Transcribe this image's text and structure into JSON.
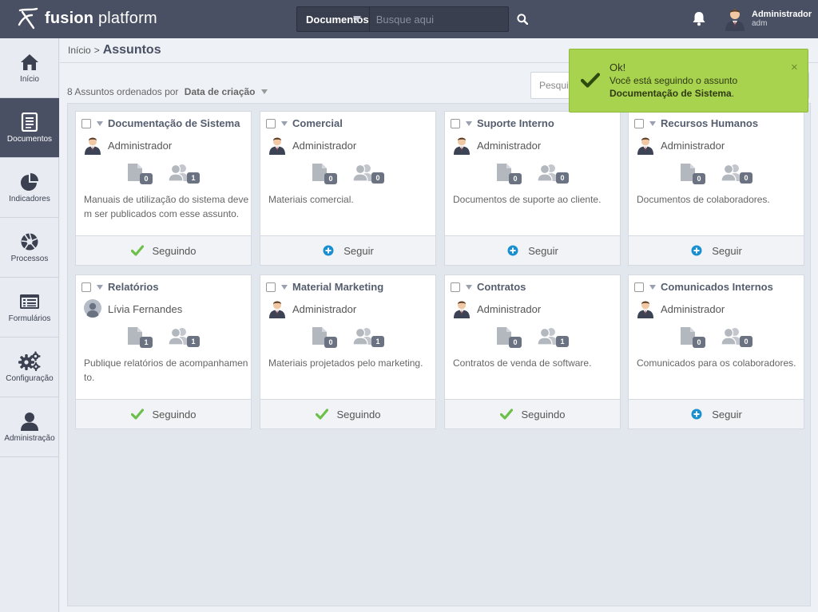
{
  "app": {
    "logo_brand": "fusion",
    "logo_suffix": " platform"
  },
  "search": {
    "module": "Documentos",
    "placeholder": "Busque aqui"
  },
  "user": {
    "name": "Administrador",
    "login": "adm"
  },
  "sidebar": {
    "items": [
      {
        "label": "Início",
        "icon": "home-icon"
      },
      {
        "label": "Documentos",
        "icon": "document-icon",
        "active": true
      },
      {
        "label": "Indicadores",
        "icon": "pie-chart-icon"
      },
      {
        "label": "Processos",
        "icon": "aperture-icon"
      },
      {
        "label": "Formulários",
        "icon": "form-icon"
      },
      {
        "label": "Configuração",
        "icon": "gears-icon"
      },
      {
        "label": "Administração",
        "icon": "user-icon"
      }
    ]
  },
  "breadcrumb": {
    "home": "Início",
    "separator": ">",
    "current": "Assuntos"
  },
  "list": {
    "count_text": "8 Assuntos ordenados por",
    "sort_field": "Data de criação",
    "search_placeholder": "Pesquisar"
  },
  "colors": {
    "topbar": "#4a5063",
    "toast": "#a8d34e",
    "following": "#6cc04a",
    "follow": "#1a8fd0"
  },
  "cards": [
    {
      "title": "Documentação de Sistema",
      "owner": "Administrador",
      "owner_avatar": "suit",
      "docs": "0",
      "followers": "1",
      "description": "Manuais de utilização do sistema devem ser publicados com esse assunto.",
      "following": true,
      "action": "Seguindo"
    },
    {
      "title": "Comercial",
      "owner": "Administrador",
      "owner_avatar": "suit",
      "docs": "0",
      "followers": "0",
      "description": "Materiais comercial.",
      "following": false,
      "action": "Seguir"
    },
    {
      "title": "Suporte Interno",
      "owner": "Administrador",
      "owner_avatar": "suit",
      "docs": "0",
      "followers": "0",
      "description": "Documentos de suporte ao cliente.",
      "following": false,
      "action": "Seguir"
    },
    {
      "title": "Recursos Humanos",
      "owner": "Administrador",
      "owner_avatar": "suit",
      "docs": "0",
      "followers": "0",
      "description": "Documentos de colaboradores.",
      "following": false,
      "action": "Seguir"
    },
    {
      "title": "Relatórios",
      "owner": "Lívia Fernandes",
      "owner_avatar": "generic",
      "docs": "1",
      "followers": "1",
      "description": "Publique relatórios de acompanhamento.",
      "following": true,
      "action": "Seguindo"
    },
    {
      "title": "Material Marketing",
      "owner": "Administrador",
      "owner_avatar": "suit",
      "docs": "0",
      "followers": "1",
      "description": "Materiais projetados pelo marketing.",
      "following": true,
      "action": "Seguindo"
    },
    {
      "title": "Contratos",
      "owner": "Administrador",
      "owner_avatar": "suit",
      "docs": "0",
      "followers": "1",
      "description": "Contratos de venda de software.",
      "following": true,
      "action": "Seguindo"
    },
    {
      "title": "Comunicados Internos",
      "owner": "Administrador",
      "owner_avatar": "suit",
      "docs": "0",
      "followers": "0",
      "description": "Comunicados para os colaboradores.",
      "following": false,
      "action": "Seguir"
    }
  ],
  "toast": {
    "title": "Ok!",
    "message": "Você está seguindo o assunto",
    "subject": "Documentação de Sistema",
    "suffix": ".",
    "close": "×"
  }
}
